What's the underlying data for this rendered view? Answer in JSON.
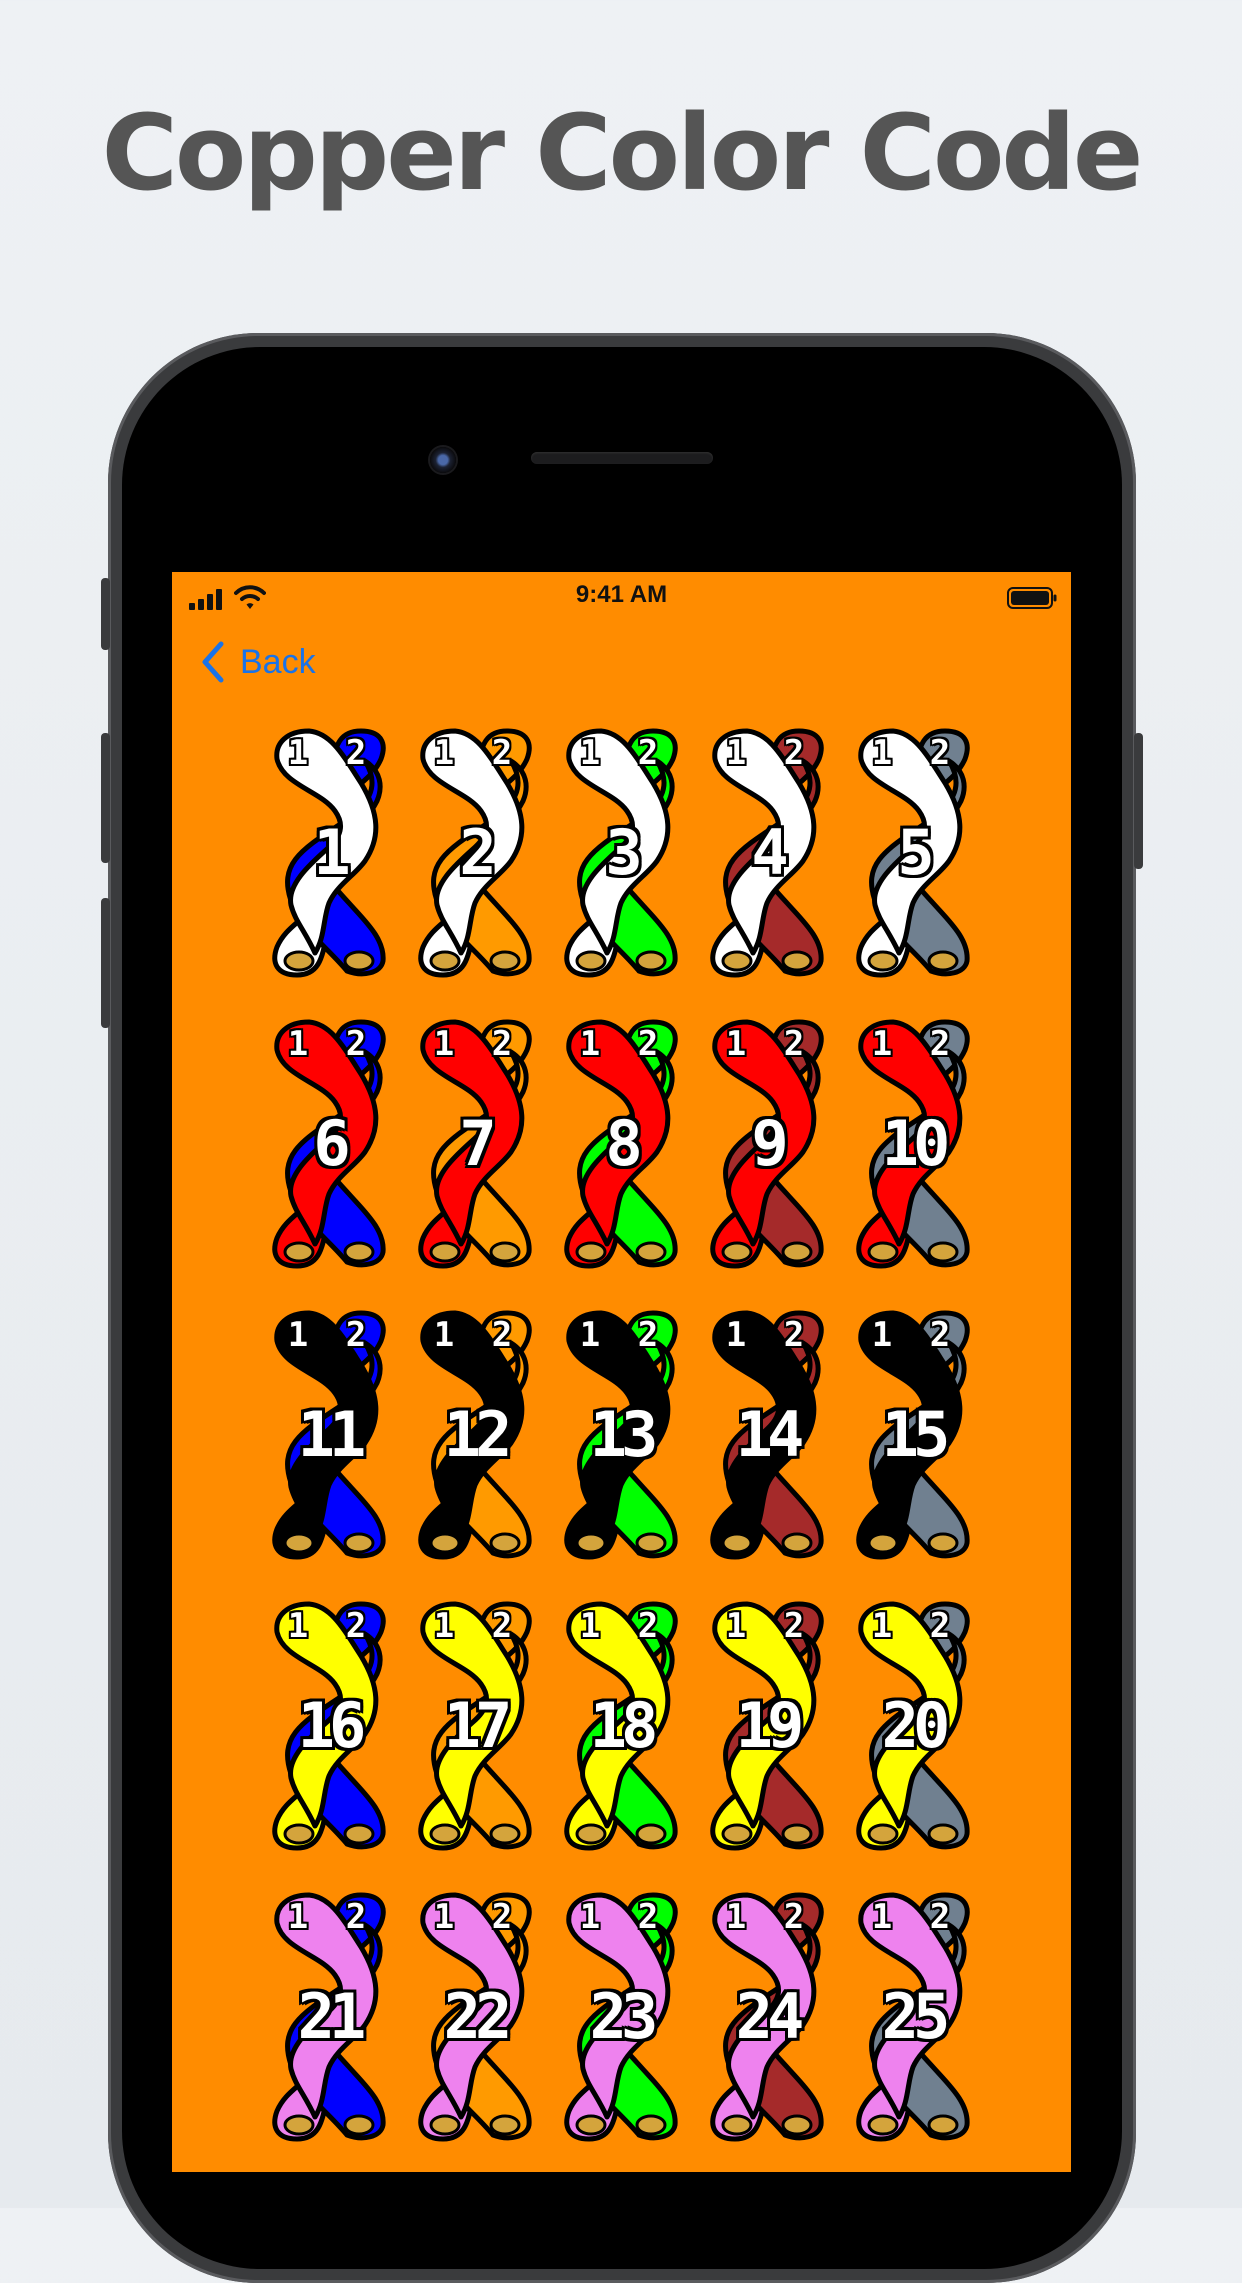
{
  "headline": "Copper Color Code",
  "status_bar": {
    "time": "9:41 AM"
  },
  "nav": {
    "back_label": "Back"
  },
  "colors": {
    "screen_background": "#ff8c00",
    "link": "#1a73e8",
    "copper": "#d4a43c",
    "outline": "#000000"
  },
  "wire_colors": {
    "white": "#ffffff",
    "red": "#ff0000",
    "black": "#000000",
    "yellow": "#ffff00",
    "violet": "#ee82ee",
    "blue": "#0000ff",
    "orange": "#ff9a00",
    "green": "#00ff00",
    "brown": "#a52a2a",
    "slate": "#708090"
  },
  "pairs": [
    {
      "number": "1",
      "tip": "white",
      "ring": "blue",
      "tip_label": "1",
      "ring_label": "2"
    },
    {
      "number": "2",
      "tip": "white",
      "ring": "orange",
      "tip_label": "1",
      "ring_label": "2"
    },
    {
      "number": "3",
      "tip": "white",
      "ring": "green",
      "tip_label": "1",
      "ring_label": "2"
    },
    {
      "number": "4",
      "tip": "white",
      "ring": "brown",
      "tip_label": "1",
      "ring_label": "2"
    },
    {
      "number": "5",
      "tip": "white",
      "ring": "slate",
      "tip_label": "1",
      "ring_label": "2"
    },
    {
      "number": "6",
      "tip": "red",
      "ring": "blue",
      "tip_label": "1",
      "ring_label": "2"
    },
    {
      "number": "7",
      "tip": "red",
      "ring": "orange",
      "tip_label": "1",
      "ring_label": "2"
    },
    {
      "number": "8",
      "tip": "red",
      "ring": "green",
      "tip_label": "1",
      "ring_label": "2"
    },
    {
      "number": "9",
      "tip": "red",
      "ring": "brown",
      "tip_label": "1",
      "ring_label": "2"
    },
    {
      "number": "10",
      "tip": "red",
      "ring": "slate",
      "tip_label": "1",
      "ring_label": "2"
    },
    {
      "number": "11",
      "tip": "black",
      "ring": "blue",
      "tip_label": "1",
      "ring_label": "2"
    },
    {
      "number": "12",
      "tip": "black",
      "ring": "orange",
      "tip_label": "1",
      "ring_label": "2"
    },
    {
      "number": "13",
      "tip": "black",
      "ring": "green",
      "tip_label": "1",
      "ring_label": "2"
    },
    {
      "number": "14",
      "tip": "black",
      "ring": "brown",
      "tip_label": "1",
      "ring_label": "2"
    },
    {
      "number": "15",
      "tip": "black",
      "ring": "slate",
      "tip_label": "1",
      "ring_label": "2"
    },
    {
      "number": "16",
      "tip": "yellow",
      "ring": "blue",
      "tip_label": "1",
      "ring_label": "2"
    },
    {
      "number": "17",
      "tip": "yellow",
      "ring": "orange",
      "tip_label": "1",
      "ring_label": "2"
    },
    {
      "number": "18",
      "tip": "yellow",
      "ring": "green",
      "tip_label": "1",
      "ring_label": "2"
    },
    {
      "number": "19",
      "tip": "yellow",
      "ring": "brown",
      "tip_label": "1",
      "ring_label": "2"
    },
    {
      "number": "20",
      "tip": "yellow",
      "ring": "slate",
      "tip_label": "1",
      "ring_label": "2"
    },
    {
      "number": "21",
      "tip": "violet",
      "ring": "blue",
      "tip_label": "1",
      "ring_label": "2"
    },
    {
      "number": "22",
      "tip": "violet",
      "ring": "orange",
      "tip_label": "1",
      "ring_label": "2"
    },
    {
      "number": "23",
      "tip": "violet",
      "ring": "green",
      "tip_label": "1",
      "ring_label": "2"
    },
    {
      "number": "24",
      "tip": "violet",
      "ring": "brown",
      "tip_label": "1",
      "ring_label": "2"
    },
    {
      "number": "25",
      "tip": "violet",
      "ring": "slate",
      "tip_label": "1",
      "ring_label": "2"
    }
  ]
}
